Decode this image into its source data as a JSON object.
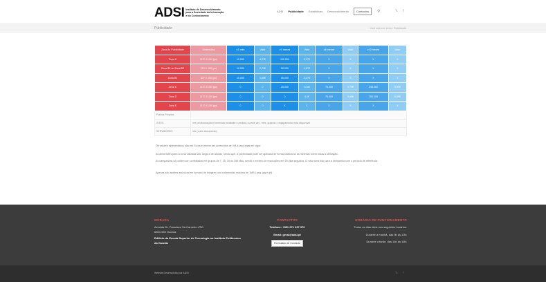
{
  "header": {
    "logo_mark": "ADSI",
    "logo_text": "Instituto de Desenvolvimento para a Sociedade da Informação e do Conhecimento",
    "nav": [
      "ADSI",
      "Publicidade",
      "Estatísticas",
      "Desenvolvimento"
    ],
    "contact_label": "Contactos",
    "search_icon": "search-icon",
    "social": [
      "twitter-icon",
      "facebook-icon"
    ]
  },
  "titlebar": {
    "title": "Publicidade",
    "crumbs": "Você está em: Início / Publicidade"
  },
  "table": {
    "headers": [
      "Zona de Publicidade",
      "Dimensões",
      "≤1 mês",
      "Valor",
      "≥3 meses",
      "Valor",
      "≥6 meses",
      "Valor",
      "≥12 meses",
      "Valor"
    ],
    "rows": [
      [
        "Zona A",
        "1170 X 150 (px)",
        "10.000",
        "4,27€",
        "100.000",
        "3,27€",
        "X",
        "X",
        "X",
        "X"
      ],
      [
        "Zona B1 ou Zona B2",
        "210 X 150 (px)",
        "10.000",
        "2,79€",
        "50.000",
        "1,57€",
        "X",
        "X",
        "X",
        "X"
      ],
      [
        "Zona B3",
        "427 X 150 (px)",
        "10.000",
        "1,60€",
        "50.000",
        "2,37€",
        "X",
        "X",
        "X",
        "X"
      ],
      [
        "Zona C",
        "1170 X 150 (px)",
        "0",
        "0",
        "25.000",
        "13,0€",
        "75.000",
        "2,79€",
        "245.000",
        "5,99€"
      ],
      [
        "Zona D",
        "1170 X 150 (px)",
        "0",
        "0",
        "0",
        "0,0€",
        "75.000",
        "3,49€",
        "160.000",
        "6,99€"
      ],
      [
        "Zona E",
        "1170 X 150 (px)",
        "0",
        "0",
        "X",
        "X",
        "X",
        "X",
        "X",
        "X"
      ]
    ],
    "info": [
      [
        "Pontos Próprios",
        ""
      ],
      [
        "SITES",
        "ver (a informação é fornecida mediante o pedido) a partir de 1 mês, quando o equipamento está disponível"
      ],
      [
        "SERVIDORES",
        "Ver (outro documento)"
      ]
    ]
  },
  "notes": [
    "Os valores apresentados são em Euros e devem ser acrescidos de IVA à taxa legal em vigor.",
    "As dimensões para a zona utilizada são: largura de alturas, sendo que, a publicidade pode ser aplicada de forma rotativa se as mesmas forem todas a utilização.",
    "As campanhas só podem ser contratadas em grupos de 7, 15, 30 ou 365 dias, sendo o mínimo de resoluções em 90 dias seguidos. O valor será tido para a campanha com o período de referência.",
    "Apenas são aceites anúncios em formato de imagem com a dimensão máxima de 1MB (.png, jpg e gif)."
  ],
  "footer": {
    "col1_title": "MORADA",
    "col1_lines": [
      "Avenida Dr. Francisco Sá Carneiro nº50",
      "6300-559 Guarda"
    ],
    "col1_strong": "Edifício da Escola Superior de Tecnologia no Instituto Politécnico da Guarda",
    "col2_title": "CONTACTOS",
    "col2_phone": "Telefone: +351 271 237 370",
    "col2_email": "Email: geral@adsi.pt",
    "col2_button": "Formulário de Contacto",
    "col3_title": "HORÁRIO DE FUNCIONAMENTO",
    "col3_lines": [
      "Todos os dias úteis nos seguintes horários:",
      "Durante a manhã, das 9h às 13h;",
      "Durante a tarde, das 14h às 18h;"
    ]
  },
  "bottom": {
    "copyright": "Website Desenvolvido por ADSI",
    "social": [
      "twitter-icon",
      "facebook-icon"
    ]
  },
  "colors": {
    "red": "#e2454b",
    "pink": "#ea9aa0",
    "blue": "#1d8fe6",
    "light_blue": "#5bb4ec",
    "footer_bg": "#3c3c3c",
    "footer_accent": "#e0534f"
  }
}
